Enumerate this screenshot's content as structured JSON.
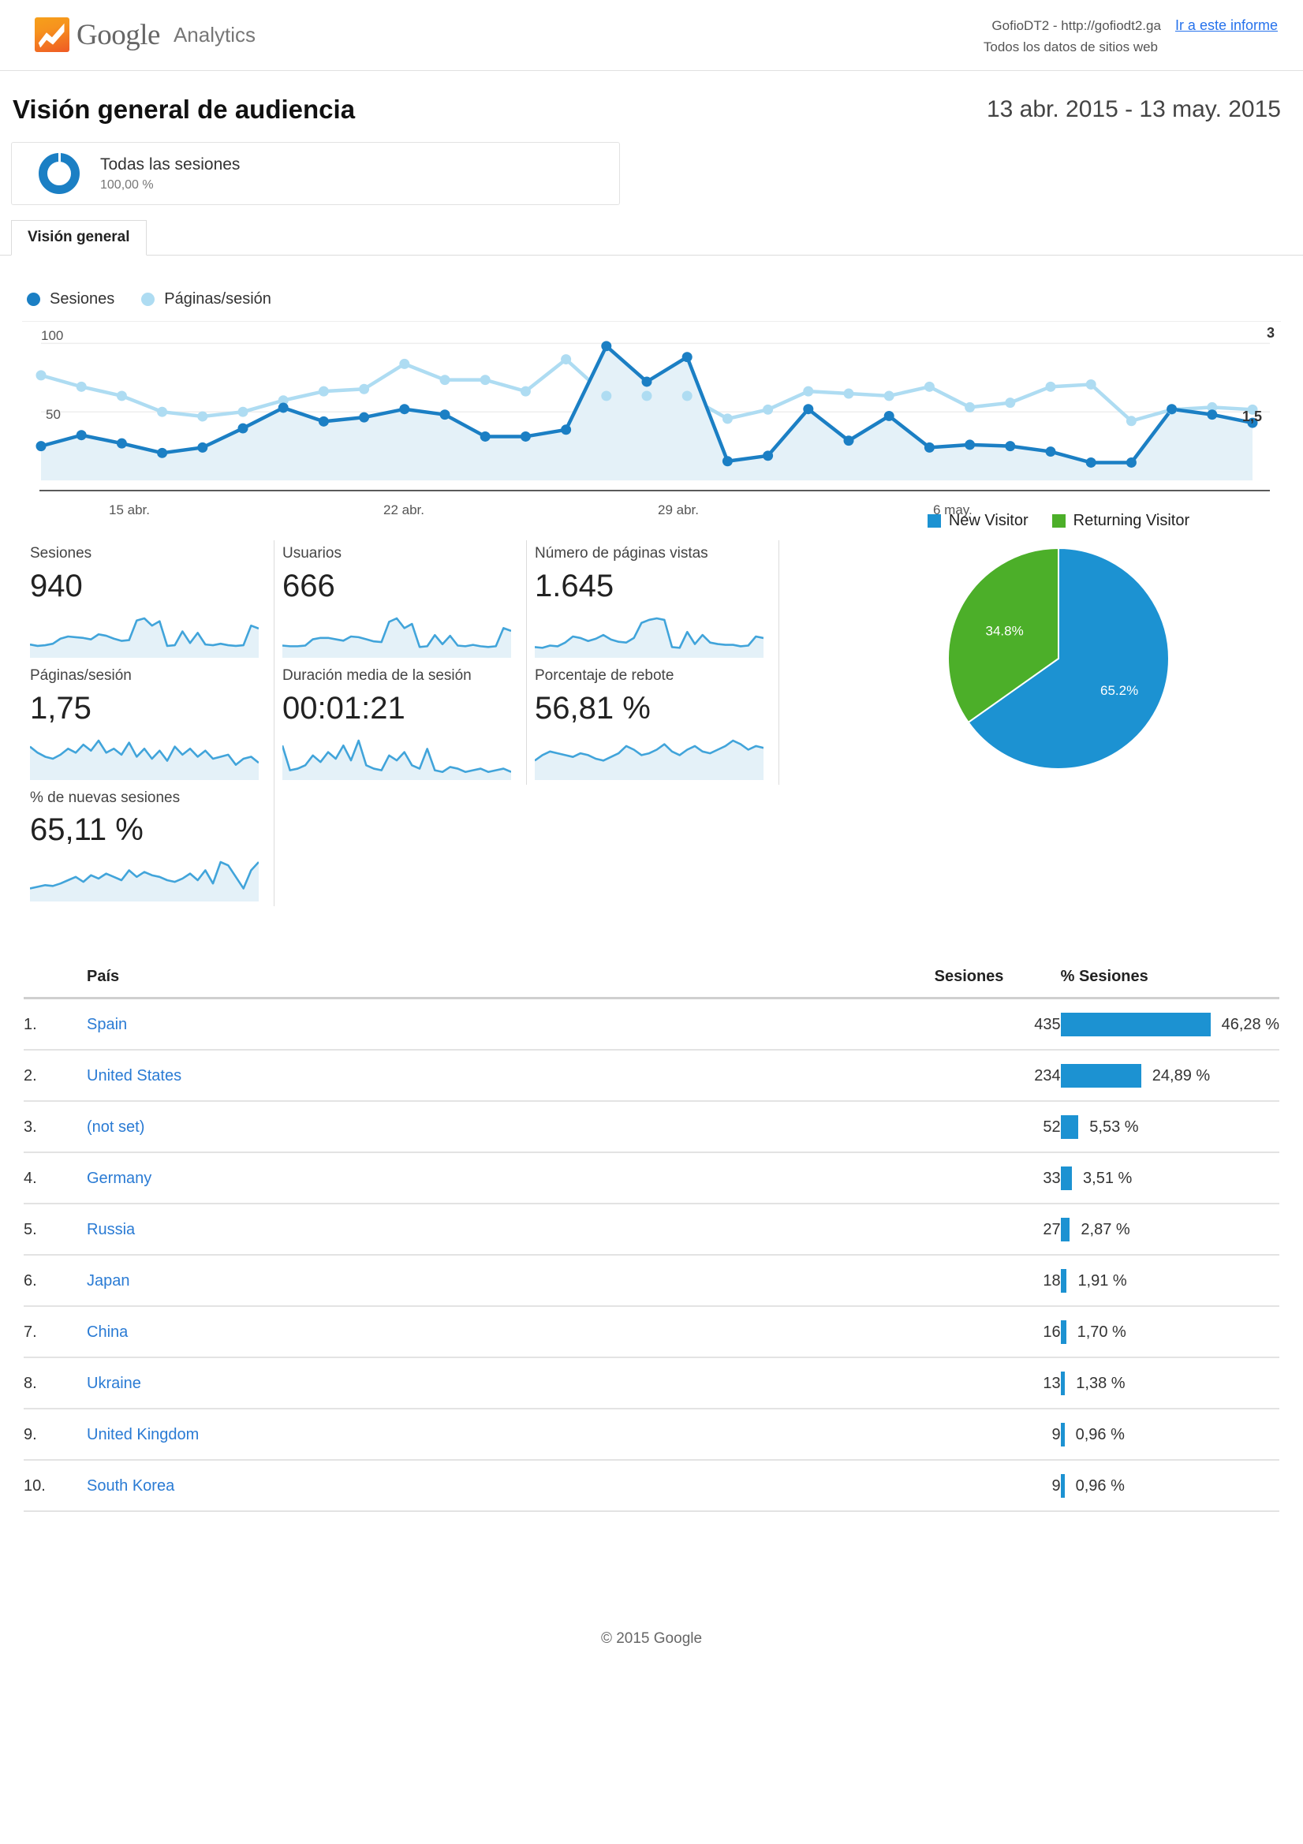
{
  "header": {
    "logo_google": "Google",
    "logo_analytics": "Analytics",
    "property": "GofioDT2 - http://gofiodt2.ga",
    "property_sub": "Todos los datos de sitios web",
    "report_link": "Ir a este informe"
  },
  "title": {
    "page_title": "Visión general de audiencia",
    "date_range": "13 abr. 2015 - 13 may. 2015"
  },
  "segment": {
    "name": "Todas las sesiones",
    "percent": "100,00 %"
  },
  "tabs": [
    {
      "label": "Visión general",
      "active": true
    }
  ],
  "main_chart_legend": [
    {
      "label": "Sesiones",
      "color": "#1b7fc4"
    },
    {
      "label": "Páginas/sesión",
      "color": "#aedcf2"
    }
  ],
  "metrics": [
    {
      "label": "Sesiones",
      "value": "940"
    },
    {
      "label": "Usuarios",
      "value": "666"
    },
    {
      "label": "Número de páginas vistas",
      "value": "1.645"
    },
    {
      "label": "Páginas/sesión",
      "value": "1,75"
    },
    {
      "label": "Duración media de la sesión",
      "value": "00:01:21"
    },
    {
      "label": "Porcentaje de rebote",
      "value": "56,81 %"
    },
    {
      "label": "% de nuevas sesiones",
      "value": "65,11 %"
    }
  ],
  "pie_legend": [
    {
      "label": "New Visitor",
      "color": "#1c92d2"
    },
    {
      "label": "Returning Visitor",
      "color": "#4caf29"
    }
  ],
  "country_table": {
    "columns": [
      "País",
      "Sesiones",
      "% Sesiones"
    ],
    "rows": [
      {
        "rank": "1.",
        "country": "Spain",
        "sessions": "435",
        "percent": "46,28 %",
        "bar_pct": 46.28
      },
      {
        "rank": "2.",
        "country": "United States",
        "sessions": "234",
        "percent": "24,89 %",
        "bar_pct": 24.89
      },
      {
        "rank": "3.",
        "country": "(not set)",
        "sessions": "52",
        "percent": "5,53 %",
        "bar_pct": 5.53
      },
      {
        "rank": "4.",
        "country": "Germany",
        "sessions": "33",
        "percent": "3,51 %",
        "bar_pct": 3.51
      },
      {
        "rank": "5.",
        "country": "Russia",
        "sessions": "27",
        "percent": "2,87 %",
        "bar_pct": 2.87
      },
      {
        "rank": "6.",
        "country": "Japan",
        "sessions": "18",
        "percent": "1,91 %",
        "bar_pct": 1.91
      },
      {
        "rank": "7.",
        "country": "China",
        "sessions": "16",
        "percent": "1,70 %",
        "bar_pct": 1.7
      },
      {
        "rank": "8.",
        "country": "Ukraine",
        "sessions": "13",
        "percent": "1,38 %",
        "bar_pct": 1.38
      },
      {
        "rank": "9.",
        "country": "United Kingdom",
        "sessions": "9",
        "percent": "0,96 %",
        "bar_pct": 0.96
      },
      {
        "rank": "10.",
        "country": "South Korea",
        "sessions": "9",
        "percent": "0,96 %",
        "bar_pct": 0.96
      }
    ]
  },
  "footer": {
    "copyright": "© 2015 Google"
  },
  "chart_data": [
    {
      "id": "main_timeseries",
      "type": "line",
      "title": "",
      "xlabel": "",
      "ylabel": "",
      "grid": true,
      "legend_position": "top-left",
      "x": [
        "13 abr.",
        "14 abr.",
        "15 abr.",
        "16 abr.",
        "17 abr.",
        "18 abr.",
        "19 abr.",
        "20 abr.",
        "21 abr.",
        "22 abr.",
        "23 abr.",
        "24 abr.",
        "25 abr.",
        "26 abr.",
        "27 abr.",
        "28 abr.",
        "29 abr.",
        "30 abr.",
        "1 may.",
        "2 may.",
        "3 may.",
        "4 may.",
        "5 may.",
        "6 may.",
        "7 may.",
        "8 may.",
        "9 may.",
        "10 may.",
        "11 may.",
        "12 may.",
        "13 may."
      ],
      "tick_labels": [
        "15 abr.",
        "22 abr.",
        "29 abr.",
        "6 may."
      ],
      "axis_left": {
        "ticks": [
          "100",
          "50"
        ],
        "min": 0,
        "max": 110
      },
      "axis_right": {
        "ticks": [
          "3",
          "1,5"
        ],
        "min": 0,
        "max": 3.3
      },
      "series": [
        {
          "name": "Sesiones",
          "color": "#1b7fc4",
          "axis": "left",
          "values": [
            25,
            33,
            27,
            20,
            24,
            38,
            53,
            43,
            46,
            52,
            48,
            32,
            32,
            37,
            98,
            72,
            90,
            14,
            18,
            52,
            29,
            47,
            24,
            26,
            25,
            21,
            13,
            13,
            52,
            48,
            42
          ]
        },
        {
          "name": "Páginas/sesión",
          "color": "#aedcf2",
          "axis": "right",
          "values": [
            2.3,
            2.05,
            1.85,
            1.5,
            1.4,
            1.5,
            1.75,
            1.95,
            2.0,
            2.55,
            2.2,
            2.2,
            1.95,
            2.65,
            1.85,
            1.85,
            1.85,
            1.35,
            1.55,
            1.95,
            1.9,
            1.85,
            2.05,
            1.6,
            1.7,
            2.05,
            2.1,
            1.3,
            1.55,
            1.6,
            1.55
          ]
        }
      ]
    },
    {
      "id": "new_vs_returning",
      "type": "pie",
      "title": "",
      "legend_position": "top",
      "labels": [
        "New Visitor",
        "Returning Visitor"
      ],
      "values": [
        65.2,
        34.8
      ],
      "value_labels": [
        "65.2%",
        "34.8%"
      ],
      "colors": [
        "#1c92d2",
        "#4caf29"
      ]
    },
    {
      "id": "sparkline_sesiones",
      "type": "area",
      "values": [
        14,
        12,
        13,
        15,
        22,
        25,
        24,
        23,
        21,
        28,
        26,
        22,
        19,
        20,
        47,
        50,
        40,
        46,
        12,
        13,
        32,
        16,
        30,
        14,
        13,
        15,
        13,
        12,
        13,
        40,
        36
      ]
    },
    {
      "id": "sparkline_usuarios",
      "type": "area",
      "values": [
        13,
        12,
        12,
        13,
        22,
        24,
        24,
        22,
        20,
        26,
        25,
        22,
        19,
        18,
        47,
        52,
        38,
        44,
        11,
        12,
        28,
        15,
        27,
        13,
        12,
        14,
        12,
        11,
        12,
        38,
        34
      ]
    },
    {
      "id": "sparkline_paginas_vistas",
      "type": "area",
      "values": [
        10,
        9,
        12,
        11,
        16,
        24,
        22,
        18,
        21,
        26,
        20,
        17,
        16,
        22,
        42,
        46,
        48,
        46,
        10,
        9,
        30,
        14,
        26,
        16,
        14,
        13,
        13,
        11,
        12,
        24,
        22
      ]
    },
    {
      "id": "sparkline_paginas_sesion",
      "type": "area",
      "values": [
        30,
        24,
        20,
        18,
        22,
        28,
        24,
        32,
        26,
        36,
        24,
        28,
        22,
        34,
        20,
        28,
        18,
        26,
        16,
        30,
        22,
        28,
        20,
        26,
        18,
        20,
        22,
        12,
        18,
        20,
        14
      ]
    },
    {
      "id": "sparkline_duracion",
      "type": "area",
      "values": [
        38,
        8,
        10,
        14,
        26,
        18,
        30,
        22,
        38,
        20,
        44,
        14,
        10,
        8,
        26,
        20,
        30,
        14,
        10,
        34,
        8,
        6,
        12,
        10,
        6,
        8,
        10,
        6,
        8,
        10,
        6
      ]
    },
    {
      "id": "sparkline_rebote",
      "type": "area",
      "values": [
        18,
        24,
        28,
        26,
        24,
        22,
        26,
        24,
        20,
        18,
        22,
        26,
        34,
        30,
        24,
        26,
        30,
        36,
        28,
        24,
        30,
        34,
        28,
        26,
        30,
        34,
        40,
        36,
        30,
        34,
        32
      ]
    },
    {
      "id": "sparkline_nuevas_sesiones",
      "type": "area",
      "values": [
        12,
        14,
        16,
        15,
        18,
        22,
        26,
        20,
        28,
        24,
        30,
        26,
        22,
        34,
        26,
        32,
        28,
        26,
        22,
        20,
        24,
        30,
        22,
        34,
        18,
        44,
        40,
        26,
        12,
        34,
        44
      ]
    }
  ]
}
